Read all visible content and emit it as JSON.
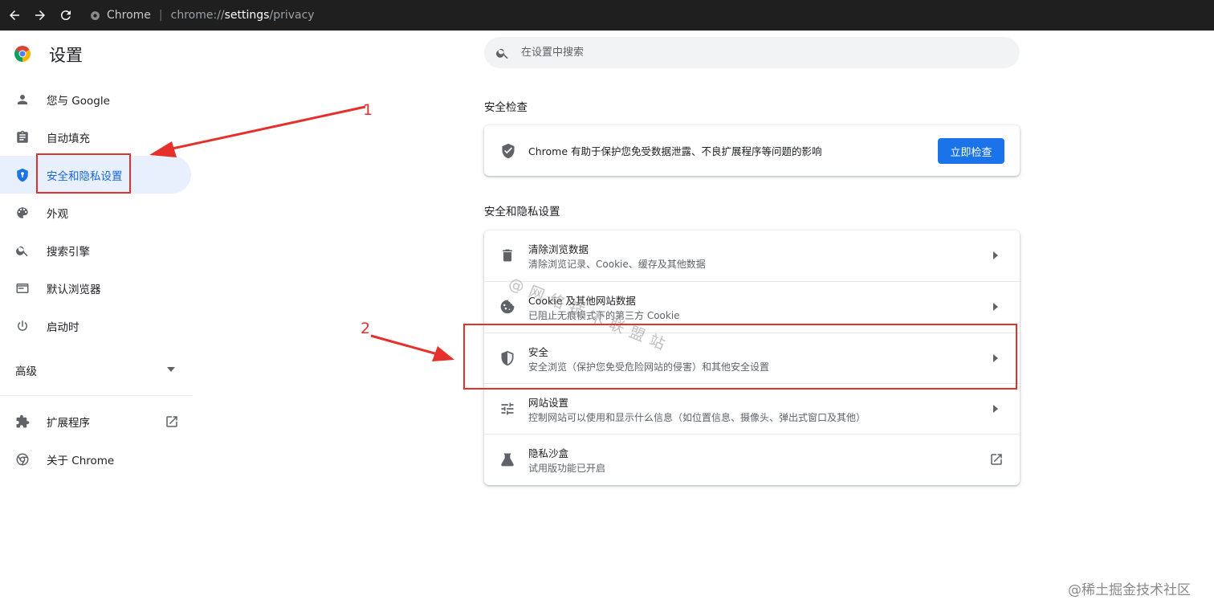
{
  "browser": {
    "site_name": "Chrome",
    "url_prefix": "chrome://",
    "url_host": "settings",
    "url_path": "/privacy"
  },
  "header": {
    "title": "设置"
  },
  "search": {
    "placeholder": "在设置中搜索"
  },
  "sidebar": {
    "items": [
      {
        "label": "您与 Google",
        "icon": "person-icon"
      },
      {
        "label": "自动填充",
        "icon": "clipboard-icon"
      },
      {
        "label": "安全和隐私设置",
        "icon": "shield-icon",
        "active": true
      },
      {
        "label": "外观",
        "icon": "palette-icon"
      },
      {
        "label": "搜索引擎",
        "icon": "search-icon"
      },
      {
        "label": "默认浏览器",
        "icon": "browser-window-icon"
      },
      {
        "label": "启动时",
        "icon": "power-icon"
      }
    ],
    "advanced_label": "高级",
    "extensions_label": "扩展程序",
    "about_label": "关于 Chrome"
  },
  "safety_check": {
    "section_title": "安全检查",
    "description": "Chrome 有助于保护您免受数据泄露、不良扩展程序等问题的影响",
    "button_label": "立即检查"
  },
  "privacy": {
    "section_title": "安全和隐私设置",
    "rows": [
      {
        "title": "清除浏览数据",
        "subtitle": "清除浏览记录、Cookie、缓存及其他数据",
        "icon": "trash-icon"
      },
      {
        "title": "Cookie 及其他网站数据",
        "subtitle": "已阻止无痕模式下的第三方 Cookie",
        "icon": "cookie-icon"
      },
      {
        "title": "安全",
        "subtitle": "安全浏览（保护您免受危险网站的侵害）和其他安全设置",
        "icon": "shield-icon"
      },
      {
        "title": "网站设置",
        "subtitle": "控制网站可以使用和显示什么信息（如位置信息、摄像头、弹出式窗口及其他）",
        "icon": "sliders-icon"
      },
      {
        "title": "隐私沙盒",
        "subtitle": "试用版功能已开启",
        "icon": "flask-icon"
      }
    ]
  },
  "annotations": {
    "label_1": "1",
    "label_2": "2",
    "color": "#e5302b"
  },
  "watermark": "@网络技术联盟站",
  "corner_watermark": "@稀土掘金技术社区",
  "colors": {
    "accent": "#1a73e8",
    "active_bg": "#e8f0fe",
    "active_text": "#1967d2"
  }
}
